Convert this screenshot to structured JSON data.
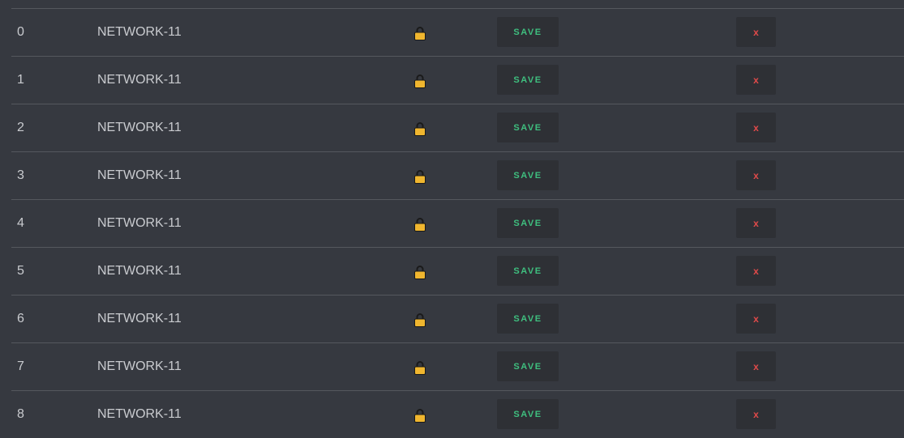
{
  "colors": {
    "background": "#363940",
    "row_divider": "#55585e",
    "text": "#c9cbcf",
    "button_bg": "#2e3035",
    "save_text": "#3fbf7f",
    "delete_text": "#e24a4a",
    "lock_body": "#f0b62f"
  },
  "icons": {
    "lock": "lock-icon"
  },
  "rows": [
    {
      "id": "0",
      "name": "NETWORK-11",
      "save_label": "SAVE",
      "delete_label": "x"
    },
    {
      "id": "1",
      "name": "NETWORK-11",
      "save_label": "SAVE",
      "delete_label": "x"
    },
    {
      "id": "2",
      "name": "NETWORK-11",
      "save_label": "SAVE",
      "delete_label": "x"
    },
    {
      "id": "3",
      "name": "NETWORK-11",
      "save_label": "SAVE",
      "delete_label": "x"
    },
    {
      "id": "4",
      "name": "NETWORK-11",
      "save_label": "SAVE",
      "delete_label": "x"
    },
    {
      "id": "5",
      "name": "NETWORK-11",
      "save_label": "SAVE",
      "delete_label": "x"
    },
    {
      "id": "6",
      "name": "NETWORK-11",
      "save_label": "SAVE",
      "delete_label": "x"
    },
    {
      "id": "7",
      "name": "NETWORK-11",
      "save_label": "SAVE",
      "delete_label": "x"
    },
    {
      "id": "8",
      "name": "NETWORK-11",
      "save_label": "SAVE",
      "delete_label": "x"
    }
  ]
}
